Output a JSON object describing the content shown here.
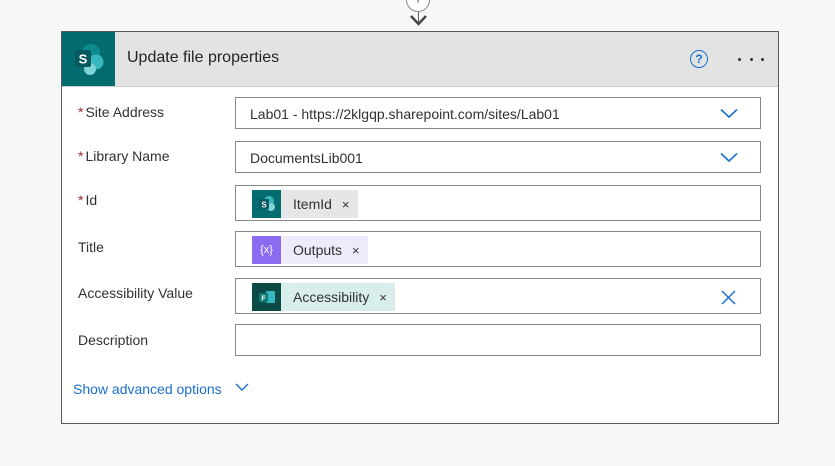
{
  "connector": {
    "plus": "+"
  },
  "card": {
    "title": "Update file properties",
    "logo_letter": "S",
    "help_glyph": "?",
    "icons": {
      "logo": "sharepoint-icon",
      "help": "help-circle-icon",
      "more": "more-options-icon"
    }
  },
  "fields": {
    "site_address": {
      "label": "Site Address",
      "required": "*",
      "value": "Lab01 - https://2klgqp.sharepoint.com/sites/Lab01"
    },
    "library_name": {
      "label": "Library Name",
      "required": "*",
      "value": "DocumentsLib001"
    },
    "id": {
      "label": "Id",
      "required": "*",
      "token": "ItemId",
      "token_icon_letter": "S",
      "token_bg": "#e6e6e6",
      "token_icon_color": "#036c70"
    },
    "title": {
      "label": "Title",
      "token": "Outputs",
      "token_icon_glyph": "{x}",
      "token_bg": "#eee9fb",
      "token_icon_color": "#8b6cf0"
    },
    "accessibility_value": {
      "label": "Accessibility Value",
      "token": "Accessibility",
      "token_icon_letter": "F",
      "token_bg": "#d8eeec",
      "token_icon_color": "#0b4a45"
    },
    "description": {
      "label": "Description",
      "value": ""
    }
  },
  "token_remove_glyph": "×",
  "advanced": {
    "label": "Show advanced options"
  },
  "colors": {
    "accent": "#1a6fcf",
    "required": "#a4262c",
    "sharepoint": "#036c70"
  }
}
